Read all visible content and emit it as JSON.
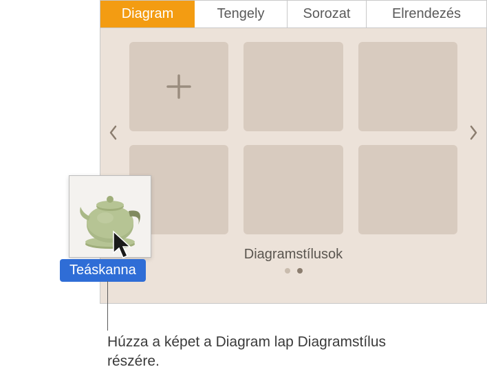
{
  "tabs": {
    "diagram": "Diagram",
    "tengely": "Tengely",
    "sorozat": "Sorozat",
    "elrendezes": "Elrendezés"
  },
  "styles": {
    "label": "Diagramstílusok"
  },
  "drag": {
    "label": "Teáskanna"
  },
  "callout": {
    "text": "Húzza a képet a Diagram lap Diagramstílus részére."
  }
}
